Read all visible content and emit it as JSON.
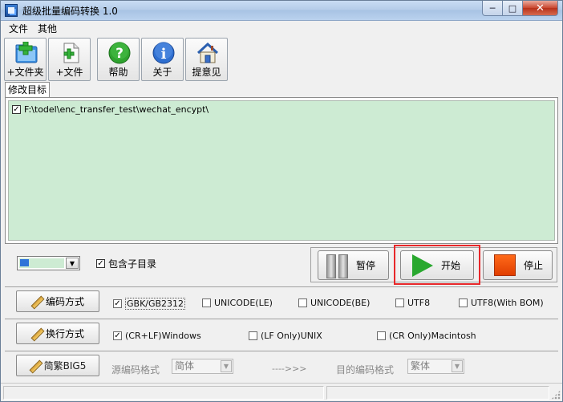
{
  "window": {
    "title": "超级批量编码转换 1.0",
    "min_glyph": "─",
    "max_glyph": "□",
    "close_glyph": "✕"
  },
  "menu": {
    "items": [
      {
        "label": "文件"
      },
      {
        "label": "其他"
      }
    ]
  },
  "toolbar": {
    "buttons": [
      {
        "label": "+文件夹",
        "icon": "add-folder-icon"
      },
      {
        "label": "+文件",
        "icon": "add-file-icon"
      },
      {
        "label": "帮助",
        "icon": "help-icon"
      },
      {
        "label": "关于",
        "icon": "info-icon"
      },
      {
        "label": "提意见",
        "icon": "home-icon"
      }
    ]
  },
  "tab": {
    "label": "修改目标"
  },
  "targets": [
    {
      "checked": true,
      "path": "F:\\todel\\enc_transfer_test\\wechat_encypt\\"
    }
  ],
  "controls": {
    "include_subdirs_label": "包含子目录",
    "include_subdirs_checked": true,
    "color_value": "#cdebd3",
    "pause_label": "暂停",
    "start_label": "开始",
    "stop_label": "停止"
  },
  "encoding": {
    "button_label": "编码方式",
    "options": [
      {
        "label": "GBK/GB2312",
        "checked": true
      },
      {
        "label": "UNICODE(LE)",
        "checked": false
      },
      {
        "label": "UNICODE(BE)",
        "checked": false
      },
      {
        "label": "UTF8",
        "checked": false
      },
      {
        "label": "UTF8(With BOM)",
        "checked": false
      }
    ]
  },
  "linebreak": {
    "button_label": "换行方式",
    "options": [
      {
        "label": "(CR+LF)Windows",
        "checked": true
      },
      {
        "label": "(LF Only)UNIX",
        "checked": false
      },
      {
        "label": "(CR Only)Macintosh",
        "checked": false
      }
    ]
  },
  "big5": {
    "button_label": "简繁BIG5",
    "source_label": "源编码格式",
    "source_value": "简体",
    "arrow": "---->>>",
    "target_label": "目的编码格式",
    "target_value": "繁体"
  },
  "colors": {
    "list_background": "#cdebd3",
    "highlight_border": "#e8272a",
    "start_icon": "#29a82f",
    "stop_icon": "#ff6a1a"
  }
}
